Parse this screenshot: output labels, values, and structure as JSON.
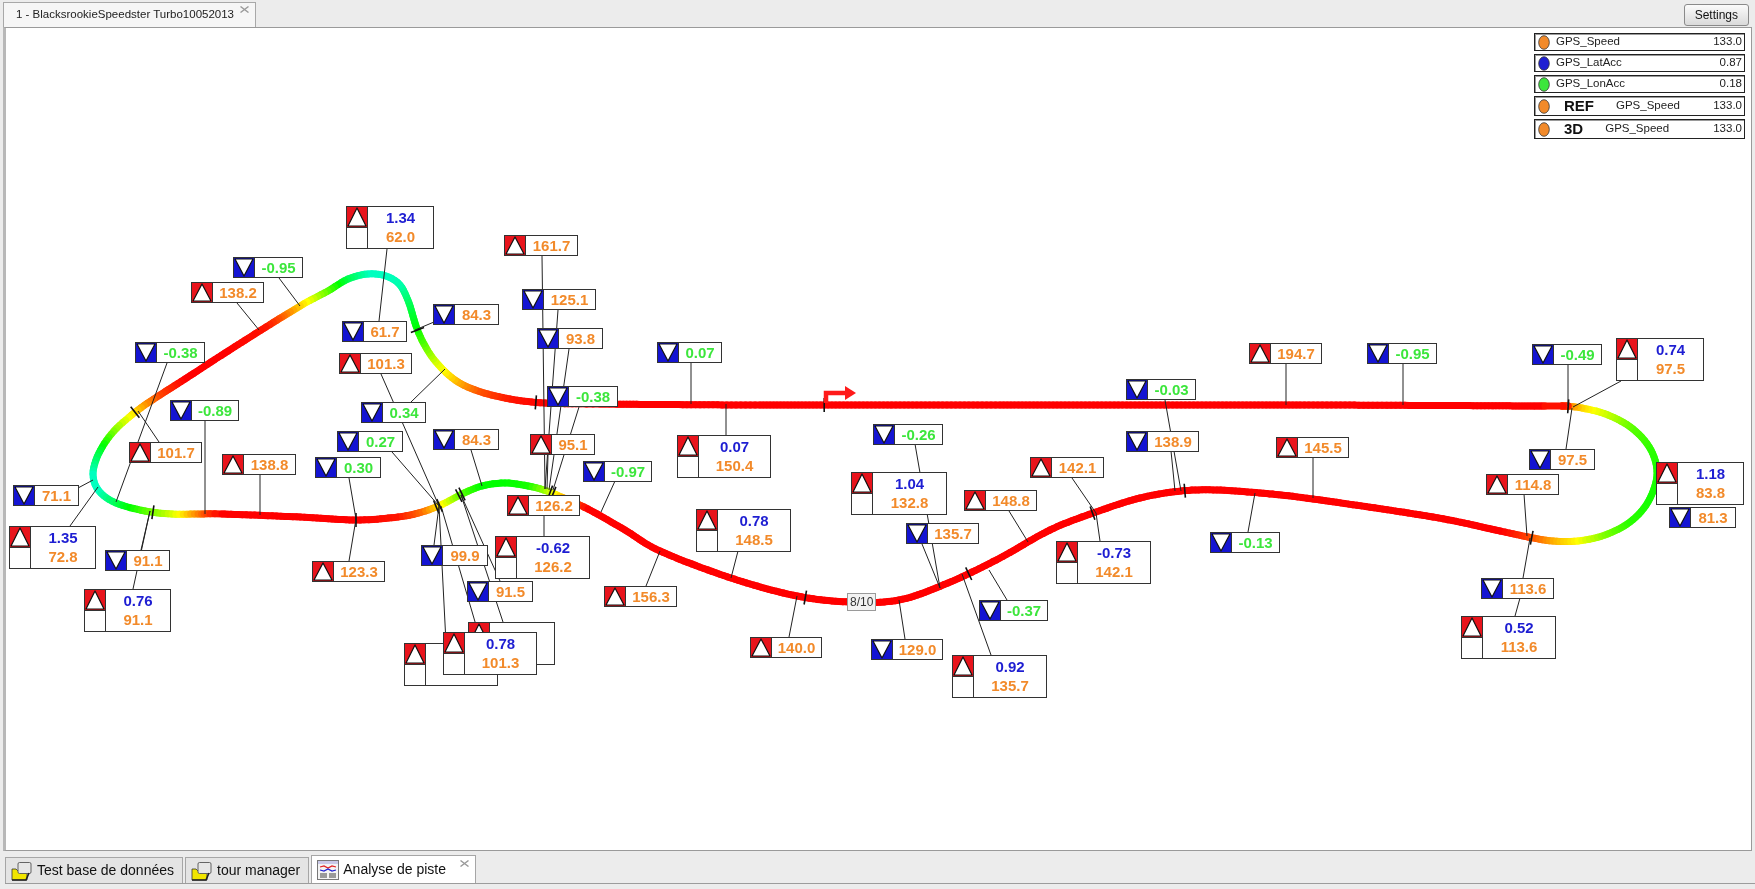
{
  "document_tab": {
    "label": "1 - BlacksrookieSpeedster Turbo10052013"
  },
  "settings_button": {
    "label": "Settings"
  },
  "legend": [
    {
      "color": "#f28a2a",
      "name": "GPS_Speed",
      "value": "133.0"
    },
    {
      "color": "#1e1ed2",
      "name": "GPS_LatAcc",
      "value": "0.87"
    },
    {
      "color": "#3ce63c",
      "name": "GPS_LonAcc",
      "value": "0.18"
    },
    {
      "color": "#f28a2a",
      "tag": "REF",
      "name": "GPS_Speed",
      "value": "133.0"
    },
    {
      "color": "#f28a2a",
      "tag": "3D",
      "name": "GPS_Speed",
      "value": "133.0"
    }
  ],
  "track_map": {
    "lap_label": "8/10",
    "callouts": [
      {
        "kind": "double",
        "maximum": true,
        "values": [
          {
            "text": "1.34",
            "color": "#1e1ed2"
          },
          {
            "text": "62.0",
            "color": "#f28a2a"
          }
        ]
      },
      {
        "kind": "single",
        "maximum": false,
        "values": [
          {
            "text": "-0.95",
            "color": "#3ce63c"
          }
        ]
      },
      {
        "kind": "single",
        "maximum": true,
        "values": [
          {
            "text": "138.2",
            "color": "#f28a2a"
          }
        ]
      },
      {
        "kind": "single",
        "maximum": false,
        "values": [
          {
            "text": "-0.38",
            "color": "#3ce63c"
          }
        ]
      },
      {
        "kind": "single",
        "maximum": false,
        "values": [
          {
            "text": "-0.89",
            "color": "#3ce63c"
          }
        ]
      },
      {
        "kind": "single",
        "maximum": true,
        "values": [
          {
            "text": "101.7",
            "color": "#f28a2a"
          }
        ]
      },
      {
        "kind": "single",
        "maximum": true,
        "values": [
          {
            "text": "138.8",
            "color": "#f28a2a"
          }
        ]
      },
      {
        "kind": "single",
        "maximum": false,
        "values": [
          {
            "text": "71.1",
            "color": "#f28a2a"
          }
        ]
      },
      {
        "kind": "double",
        "maximum": true,
        "values": [
          {
            "text": "1.35",
            "color": "#1e1ed2"
          },
          {
            "text": "72.8",
            "color": "#f28a2a"
          }
        ]
      },
      {
        "kind": "single",
        "maximum": false,
        "values": [
          {
            "text": "91.1",
            "color": "#f28a2a"
          }
        ]
      },
      {
        "kind": "double",
        "maximum": true,
        "values": [
          {
            "text": "0.76",
            "color": "#1e1ed2"
          },
          {
            "text": "91.1",
            "color": "#f28a2a"
          }
        ]
      },
      {
        "kind": "single",
        "maximum": false,
        "values": [
          {
            "text": "61.7",
            "color": "#f28a2a"
          }
        ]
      },
      {
        "kind": "single",
        "maximum": false,
        "values": [
          {
            "text": "84.3",
            "color": "#f28a2a"
          }
        ]
      },
      {
        "kind": "single",
        "maximum": true,
        "values": [
          {
            "text": "101.3",
            "color": "#f28a2a"
          }
        ]
      },
      {
        "kind": "single",
        "maximum": false,
        "values": [
          {
            "text": "0.34",
            "color": "#3ce63c"
          }
        ]
      },
      {
        "kind": "single",
        "maximum": false,
        "values": [
          {
            "text": "0.27",
            "color": "#3ce63c"
          }
        ]
      },
      {
        "kind": "single",
        "maximum": false,
        "values": [
          {
            "text": "0.30",
            "color": "#3ce63c"
          }
        ]
      },
      {
        "kind": "single",
        "maximum": false,
        "values": [
          {
            "text": "84.3",
            "color": "#f28a2a"
          }
        ]
      },
      {
        "kind": "single",
        "maximum": true,
        "values": [
          {
            "text": "123.3",
            "color": "#f28a2a"
          }
        ]
      },
      {
        "kind": "single",
        "maximum": false,
        "values": [
          {
            "text": "99.9",
            "color": "#f28a2a"
          }
        ]
      },
      {
        "kind": "single",
        "maximum": false,
        "values": [
          {
            "text": "91.5",
            "color": "#f28a2a"
          }
        ]
      },
      {
        "kind": "double",
        "maximum": true
      },
      {
        "kind": "double",
        "maximum": true,
        "values": [
          {
            "text": "0.78",
            "color": "#1e1ed2"
          },
          {
            "text": "101.3",
            "color": "#f28a2a"
          }
        ]
      },
      {
        "kind": "double",
        "maximum": true
      },
      {
        "kind": "single",
        "maximum": true,
        "values": [
          {
            "text": "161.7",
            "color": "#f28a2a"
          }
        ]
      },
      {
        "kind": "single",
        "maximum": false,
        "values": [
          {
            "text": "125.1",
            "color": "#f28a2a"
          }
        ]
      },
      {
        "kind": "single",
        "maximum": false,
        "values": [
          {
            "text": "93.8",
            "color": "#f28a2a"
          }
        ]
      },
      {
        "kind": "single",
        "maximum": false,
        "values": [
          {
            "text": "-0.38",
            "color": "#3ce63c"
          }
        ]
      },
      {
        "kind": "single",
        "maximum": false,
        "values": [
          {
            "text": "0.07",
            "color": "#3ce63c"
          }
        ]
      },
      {
        "kind": "single",
        "maximum": true,
        "values": [
          {
            "text": "95.1",
            "color": "#f28a2a"
          }
        ]
      },
      {
        "kind": "single",
        "maximum": false,
        "values": [
          {
            "text": "-0.97",
            "color": "#3ce63c"
          }
        ]
      },
      {
        "kind": "double",
        "maximum": true,
        "values": [
          {
            "text": "0.07",
            "color": "#1e1ed2"
          },
          {
            "text": "150.4",
            "color": "#f28a2a"
          }
        ]
      },
      {
        "kind": "single",
        "maximum": true,
        "values": [
          {
            "text": "126.2",
            "color": "#f28a2a"
          }
        ]
      },
      {
        "kind": "double",
        "maximum": true,
        "values": [
          {
            "text": "-0.62",
            "color": "#1e1ed2"
          },
          {
            "text": "126.2",
            "color": "#f28a2a"
          }
        ]
      },
      {
        "kind": "single",
        "maximum": true,
        "values": [
          {
            "text": "156.3",
            "color": "#f28a2a"
          }
        ]
      },
      {
        "kind": "double",
        "maximum": true,
        "values": [
          {
            "text": "0.78",
            "color": "#1e1ed2"
          },
          {
            "text": "148.5",
            "color": "#f28a2a"
          }
        ]
      },
      {
        "kind": "single",
        "maximum": true,
        "values": [
          {
            "text": "140.0",
            "color": "#f28a2a"
          }
        ]
      },
      {
        "kind": "single",
        "maximum": false,
        "values": [
          {
            "text": "-0.26",
            "color": "#3ce63c"
          }
        ]
      },
      {
        "kind": "double",
        "maximum": true,
        "values": [
          {
            "text": "1.04",
            "color": "#1e1ed2"
          },
          {
            "text": "132.8",
            "color": "#f28a2a"
          }
        ]
      },
      {
        "kind": "single",
        "maximum": false,
        "values": [
          {
            "text": "135.7",
            "color": "#f28a2a"
          }
        ]
      },
      {
        "kind": "single",
        "maximum": true,
        "values": [
          {
            "text": "148.8",
            "color": "#f28a2a"
          }
        ]
      },
      {
        "kind": "single",
        "maximum": false,
        "values": [
          {
            "text": "-0.37",
            "color": "#3ce63c"
          }
        ]
      },
      {
        "kind": "single",
        "maximum": false,
        "values": [
          {
            "text": "129.0",
            "color": "#f28a2a"
          }
        ]
      },
      {
        "kind": "double",
        "maximum": true,
        "values": [
          {
            "text": "0.92",
            "color": "#1e1ed2"
          },
          {
            "text": "135.7",
            "color": "#f28a2a"
          }
        ]
      },
      {
        "kind": "single",
        "maximum": true,
        "values": [
          {
            "text": "142.1",
            "color": "#f28a2a"
          }
        ]
      },
      {
        "kind": "double",
        "maximum": true,
        "values": [
          {
            "text": "-0.73",
            "color": "#1e1ed2"
          },
          {
            "text": "142.1",
            "color": "#f28a2a"
          }
        ]
      },
      {
        "kind": "single",
        "maximum": false,
        "values": [
          {
            "text": "-0.03",
            "color": "#3ce63c"
          }
        ]
      },
      {
        "kind": "single",
        "maximum": false,
        "values": [
          {
            "text": "138.9",
            "color": "#f28a2a"
          }
        ]
      },
      {
        "kind": "single",
        "maximum": true,
        "values": [
          {
            "text": "194.7",
            "color": "#f28a2a"
          }
        ]
      },
      {
        "kind": "single",
        "maximum": false,
        "values": [
          {
            "text": "-0.95",
            "color": "#3ce63c"
          }
        ]
      },
      {
        "kind": "single",
        "maximum": true,
        "values": [
          {
            "text": "145.5",
            "color": "#f28a2a"
          }
        ]
      },
      {
        "kind": "single",
        "maximum": false,
        "values": [
          {
            "text": "-0.13",
            "color": "#3ce63c"
          }
        ]
      },
      {
        "kind": "single",
        "maximum": false,
        "values": [
          {
            "text": "-0.49",
            "color": "#3ce63c"
          }
        ]
      },
      {
        "kind": "double",
        "maximum": true,
        "values": [
          {
            "text": "0.74",
            "color": "#1e1ed2"
          },
          {
            "text": "97.5",
            "color": "#f28a2a"
          }
        ]
      },
      {
        "kind": "single",
        "maximum": false,
        "values": [
          {
            "text": "97.5",
            "color": "#f28a2a"
          }
        ]
      },
      {
        "kind": "single",
        "maximum": true,
        "values": [
          {
            "text": "114.8",
            "color": "#f28a2a"
          }
        ]
      },
      {
        "kind": "double",
        "maximum": true,
        "values": [
          {
            "text": "1.18",
            "color": "#1e1ed2"
          },
          {
            "text": "83.8",
            "color": "#f28a2a"
          }
        ]
      },
      {
        "kind": "single",
        "maximum": false,
        "values": [
          {
            "text": "81.3",
            "color": "#f28a2a"
          }
        ]
      },
      {
        "kind": "single",
        "maximum": false,
        "values": [
          {
            "text": "113.6",
            "color": "#f28a2a"
          }
        ]
      },
      {
        "kind": "double",
        "maximum": true,
        "values": [
          {
            "text": "0.52",
            "color": "#1e1ed2"
          },
          {
            "text": "113.6",
            "color": "#f28a2a"
          }
        ]
      }
    ]
  },
  "bottom_tabs": [
    {
      "kind": "folder",
      "label": "Test base de données",
      "selected": false
    },
    {
      "kind": "folder",
      "label": "tour manager",
      "selected": false
    },
    {
      "kind": "chart",
      "label": "Analyse de piste",
      "selected": true
    }
  ]
}
